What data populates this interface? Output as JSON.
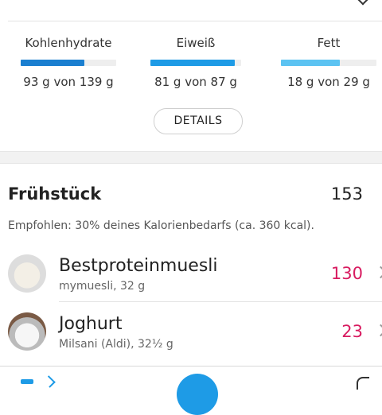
{
  "macros": {
    "carbs": {
      "label": "Kohlenhydrate",
      "amount": "93 g von 139 g",
      "progress": 0.67,
      "color": "#1a7fd0"
    },
    "protein": {
      "label": "Eiweiß",
      "amount": "81 g von 87 g",
      "progress": 0.93,
      "color": "#1e9be6"
    },
    "fat": {
      "label": "Fett",
      "amount": "18 g von 29 g",
      "progress": 0.62,
      "color": "#5cc3f2"
    }
  },
  "details_label": "DETAILS",
  "meal": {
    "title": "Frühstück",
    "calories": "153",
    "hint": "Empfohlen: 30% deines Kalorienbedarfs (ca. 360 kcal).",
    "items": [
      {
        "name": "Bestproteinmuesli",
        "detail": "mymuesli, 32 g",
        "kcal": "130",
        "icon": "muesli-bowl-image"
      },
      {
        "name": "Joghurt",
        "detail": "Milsani (Aldi), 32½ g",
        "kcal": "23",
        "icon": "yogurt-bowl-image"
      }
    ]
  },
  "colors": {
    "accent": "#1e9be6",
    "kcal": "#d81b60"
  }
}
